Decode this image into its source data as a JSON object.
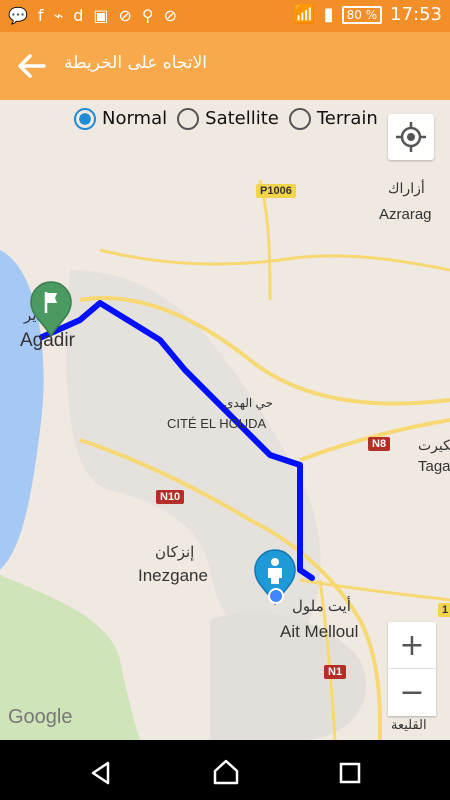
{
  "status_bar": {
    "battery": "80 %",
    "time": "17:53"
  },
  "toolbar": {
    "title": "الاتجاه على الخريطة"
  },
  "map": {
    "type_options": [
      {
        "label": "Normal",
        "selected": true
      },
      {
        "label": "Satellite",
        "selected": false
      },
      {
        "label": "Terrain",
        "selected": false
      }
    ],
    "labels": {
      "azrarag_ar": "أزاراك",
      "azrarag": "Azrarag",
      "agadir_ar": "أكادير",
      "agadir": "Agadir",
      "cite_ar": "حي الهدى",
      "cite": "CITÉ EL HOUDA",
      "inezgane_ar": "إنزكان",
      "inezgane": "Inezgane",
      "ait_ar": "أيت ملول",
      "ait": "Ait Melloul",
      "taga_ar": "تكيرت",
      "taga": "Taga",
      "qliaa_ar": "القليعة"
    },
    "roads": {
      "p1006": "P1006",
      "n8": "N8",
      "n10": "N10",
      "n1": "N1",
      "r1": "1"
    },
    "zoom_in": "+",
    "zoom_out": "−",
    "google": "Google"
  },
  "colors": {
    "status_orange": "#f28f28",
    "toolbar_orange": "#f8a94c",
    "route_blue": "#0010ff",
    "marker_green": "#4b9a62",
    "marker_blue": "#1e9ad8"
  }
}
